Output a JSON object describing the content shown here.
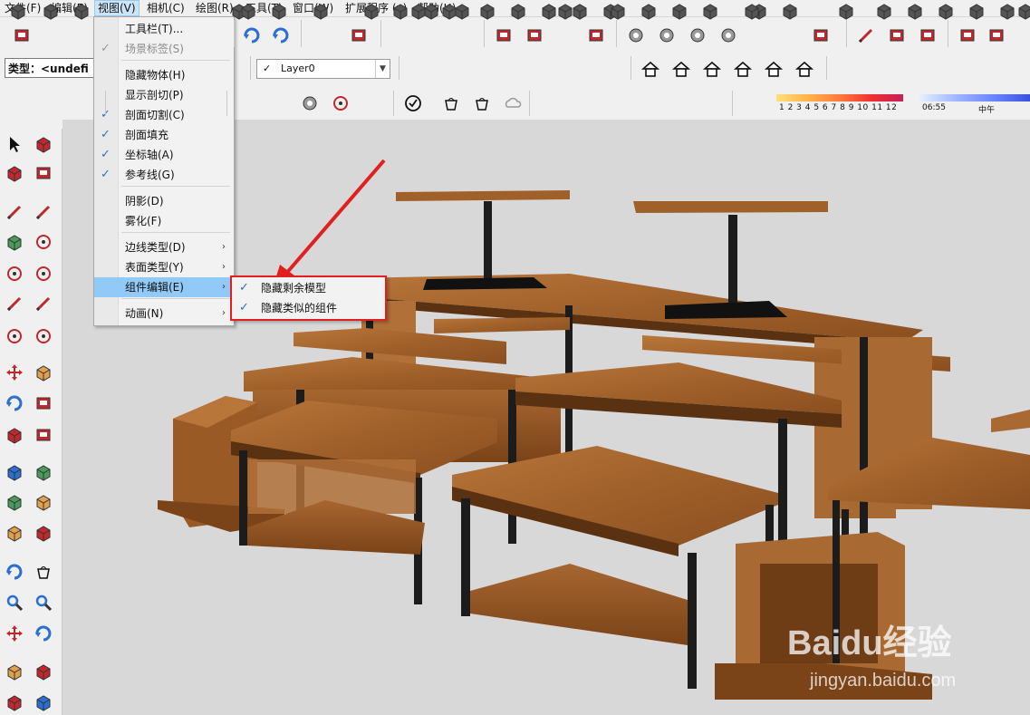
{
  "menubar": {
    "items": [
      "文件(F)",
      "编辑(E)",
      "视图(V)",
      "相机(C)",
      "绘图(R)",
      "工具(T)",
      "窗口(W)",
      "扩展程序 (x)",
      "帮助(H)"
    ],
    "active_index": 2
  },
  "entity_info": {
    "type_label": "类型：<undefi"
  },
  "layer": {
    "value": "Layer0",
    "check": "✓"
  },
  "legend": {
    "numbers": "1 2 3 4 5 6 7 8 9 10 11 12",
    "time_start": "06:55",
    "time_noon": "中午"
  },
  "view_menu": {
    "items": [
      {
        "label": "工具栏(T)...",
        "checked": false,
        "disabled": false,
        "submenu": false
      },
      {
        "label": "场景标签(S)",
        "checked": true,
        "disabled": true,
        "submenu": false
      },
      {
        "label": "隐藏物体(H)",
        "checked": false,
        "disabled": false,
        "submenu": false
      },
      {
        "label": "显示剖切(P)",
        "checked": false,
        "disabled": false,
        "submenu": false
      },
      {
        "label": "剖面切割(C)",
        "checked": true,
        "disabled": false,
        "submenu": false
      },
      {
        "label": "剖面填充",
        "checked": true,
        "disabled": false,
        "submenu": false
      },
      {
        "label": "坐标轴(A)",
        "checked": true,
        "disabled": false,
        "submenu": false
      },
      {
        "label": "参考线(G)",
        "checked": true,
        "disabled": false,
        "submenu": false
      },
      {
        "label": "阴影(D)",
        "checked": false,
        "disabled": false,
        "submenu": false
      },
      {
        "label": "雾化(F)",
        "checked": false,
        "disabled": false,
        "submenu": false
      },
      {
        "label": "边线类型(D)",
        "checked": false,
        "disabled": false,
        "submenu": true
      },
      {
        "label": "表面类型(Y)",
        "checked": false,
        "disabled": false,
        "submenu": true
      },
      {
        "label": "组件编辑(E)",
        "checked": false,
        "disabled": false,
        "submenu": true,
        "highlighted": true
      },
      {
        "label": "动画(N)",
        "checked": false,
        "disabled": false,
        "submenu": true
      }
    ]
  },
  "component_edit_submenu": {
    "items": [
      {
        "label": "隐藏剩余模型",
        "checked": true
      },
      {
        "label": "隐藏类似的组件",
        "checked": true
      }
    ]
  },
  "watermark": {
    "brand": "Baidu经验",
    "url": "jingyan.baidu.com"
  },
  "colors": {
    "highlight": "#91c9f7",
    "annotation": "#e02020",
    "wood": "#a0602a",
    "steel": "#1c1c1c"
  }
}
